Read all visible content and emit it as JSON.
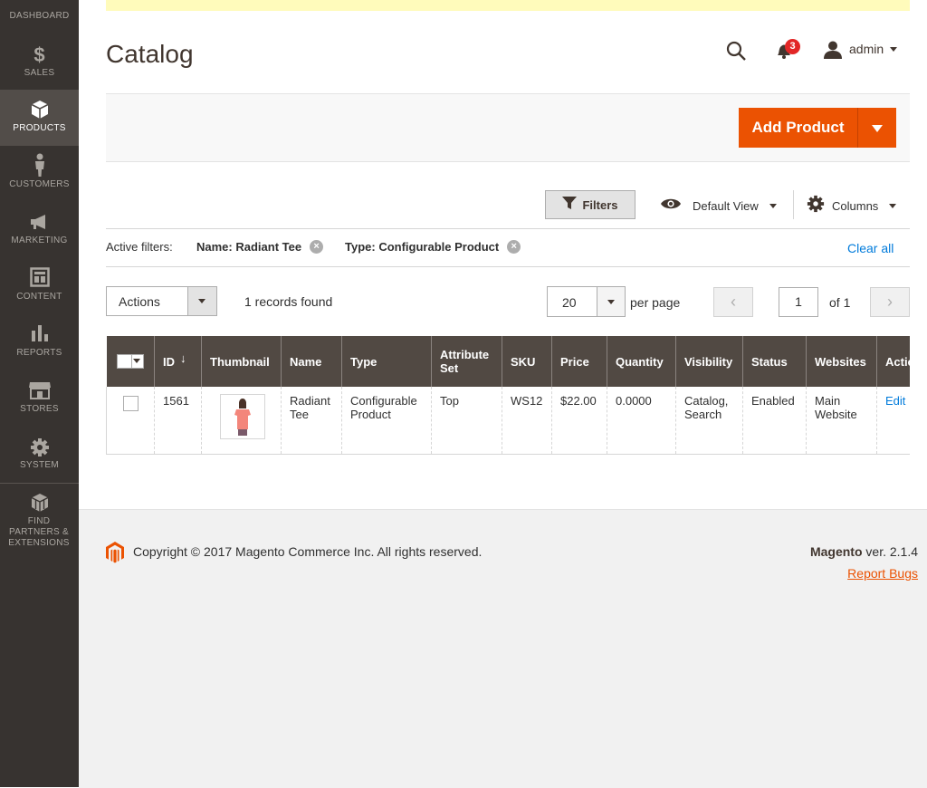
{
  "sidebar": {
    "items": [
      {
        "label": "DASHBOARD",
        "icon": "dashboard-icon"
      },
      {
        "label": "SALES",
        "icon": "dollar-icon"
      },
      {
        "label": "PRODUCTS",
        "icon": "cube-icon",
        "active": true
      },
      {
        "label": "CUSTOMERS",
        "icon": "person-icon"
      },
      {
        "label": "MARKETING",
        "icon": "megaphone-icon"
      },
      {
        "label": "CONTENT",
        "icon": "layout-icon"
      },
      {
        "label": "REPORTS",
        "icon": "bar-chart-icon"
      },
      {
        "label": "STORES",
        "icon": "storefront-icon"
      },
      {
        "label": "SYSTEM",
        "icon": "gear-icon"
      },
      {
        "label": "FIND PARTNERS & EXTENSIONS",
        "icon": "blocks-icon"
      }
    ]
  },
  "header": {
    "title": "Catalog",
    "notifications_count": "3",
    "user_name": "admin"
  },
  "page_actions": {
    "add_product_label": "Add Product"
  },
  "toolbar": {
    "filters_label": "Filters",
    "view_label": "Default View",
    "columns_label": "Columns"
  },
  "active_filters": {
    "label": "Active filters:",
    "chips": [
      "Name: Radiant Tee",
      "Type: Configurable Product"
    ],
    "clear_all": "Clear all"
  },
  "grid_controls": {
    "actions_label": "Actions",
    "records_found": "1 records found",
    "per_page_value": "20",
    "per_page_label": "per page",
    "page_current": "1",
    "page_total_label": "of 1",
    "prev_symbol": "‹",
    "next_symbol": "›"
  },
  "table": {
    "columns": [
      "ID",
      "Thumbnail",
      "Name",
      "Type",
      "Attribute Set",
      "SKU",
      "Price",
      "Quantity",
      "Visibility",
      "Status",
      "Websites",
      "Action"
    ],
    "sort_indicator": "↓",
    "rows": [
      {
        "id": "1561",
        "name": "Radiant Tee",
        "type": "Configurable Product",
        "attribute_set": "Top",
        "sku": "WS12",
        "price": "$22.00",
        "quantity": "0.0000",
        "visibility": "Catalog, Search",
        "status": "Enabled",
        "websites": "Main Website",
        "action": "Edit"
      }
    ]
  },
  "footer": {
    "copyright": "Copyright © 2017 Magento Commerce Inc. All rights reserved.",
    "brand": "Magento",
    "version": " ver. 2.1.4",
    "report_bugs": "Report Bugs"
  },
  "colors": {
    "sidebar_bg": "#373330",
    "accent": "#eb5202",
    "header_row": "#514943",
    "link": "#007bdb"
  }
}
